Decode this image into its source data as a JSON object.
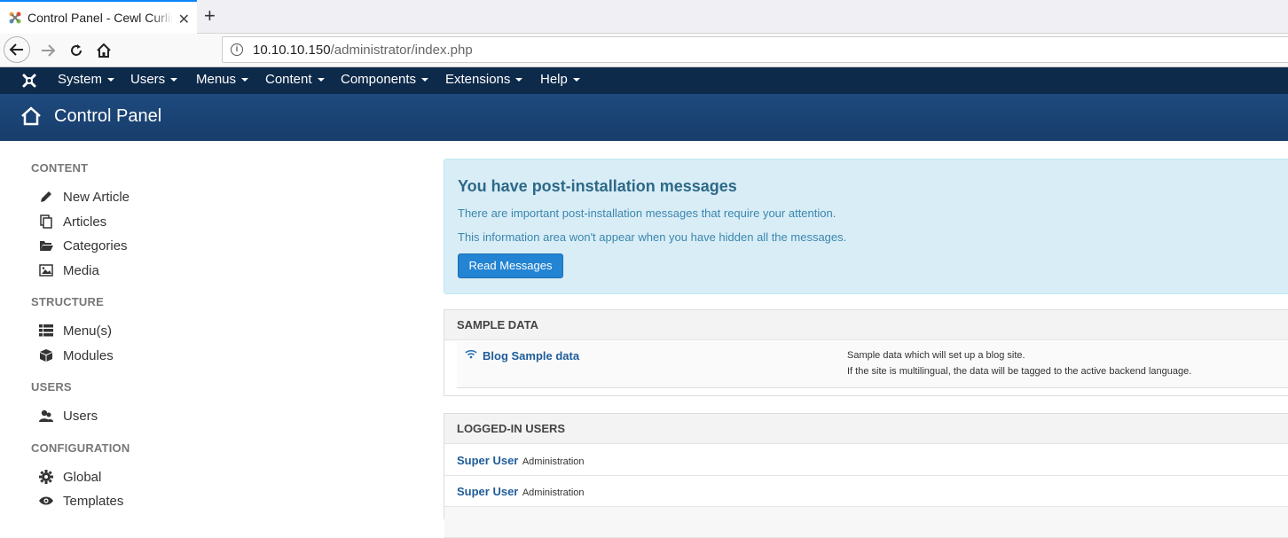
{
  "browser": {
    "tab_title": "Control Panel - Cewl Curling",
    "new_tab": "+",
    "close_tab": "✕",
    "url_host": "10.10.10.150",
    "url_path": "/administrator/index.php"
  },
  "menu": {
    "items": [
      "System",
      "Users",
      "Menus",
      "Content",
      "Components",
      "Extensions",
      "Help"
    ]
  },
  "header": {
    "title": "Control Panel"
  },
  "sidebar": {
    "content_heading": "CONTENT",
    "new_article": "New Article",
    "articles": "Articles",
    "categories": "Categories",
    "media": "Media",
    "structure_heading": "STRUCTURE",
    "menus": "Menu(s)",
    "modules": "Modules",
    "users_heading": "USERS",
    "users": "Users",
    "config_heading": "CONFIGURATION",
    "global": "Global",
    "templates": "Templates"
  },
  "alert": {
    "title": "You have post-installation messages",
    "line1": "There are important post-installation messages that require your attention.",
    "line2": "This information area won't appear when you have hidden all the messages.",
    "button": "Read Messages"
  },
  "sample_data": {
    "heading": "SAMPLE DATA",
    "link": "Blog Sample data",
    "desc1": "Sample data which will set up a blog site.",
    "desc2": "If the site is multilingual, the data will be tagged to the active backend language."
  },
  "logged_in": {
    "heading": "LOGGED-IN USERS",
    "rows": [
      {
        "name": "Super User",
        "area": "Administration"
      },
      {
        "name": "Super User",
        "area": "Administration"
      }
    ]
  }
}
